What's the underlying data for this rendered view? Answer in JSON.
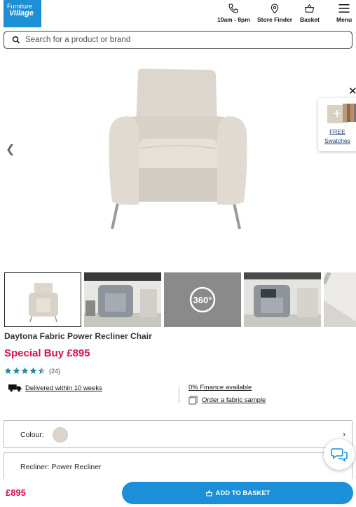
{
  "header": {
    "logo_line1": "Furniture",
    "logo_line2": "Village",
    "nav": [
      {
        "label": "10am - 8pm",
        "icon": "phone-icon"
      },
      {
        "label": "Store Finder",
        "icon": "location-pin-icon"
      },
      {
        "label": "Basket",
        "icon": "basket-icon"
      },
      {
        "label": "Menu",
        "icon": "hamburger-menu-icon"
      }
    ]
  },
  "search": {
    "placeholder": "Search for a product or brand"
  },
  "swatches_popup": {
    "line1": "FREE",
    "line2": "Swatches"
  },
  "thumbnails": {
    "spin_label": "360°"
  },
  "product": {
    "title": "Daytona Fabric Power Recliner Chair",
    "price": "Special Buy £895",
    "rating": 4.5,
    "review_count": "(24)",
    "delivery": "Delivered within 10 weeks",
    "finance": "0% Finance available",
    "sample": "Order a fabric sample"
  },
  "options": {
    "colour_label": "Colour:",
    "colour_value": "#ddd3c8",
    "recliner_label": "Recliner: Power Recliner"
  },
  "bottom_bar": {
    "price": "£895",
    "button": "ADD TO BASKET"
  },
  "colors": {
    "brand_blue": "#1b8fd7",
    "price_pink": "#d6134a",
    "star_blue": "#2a8ca0"
  }
}
